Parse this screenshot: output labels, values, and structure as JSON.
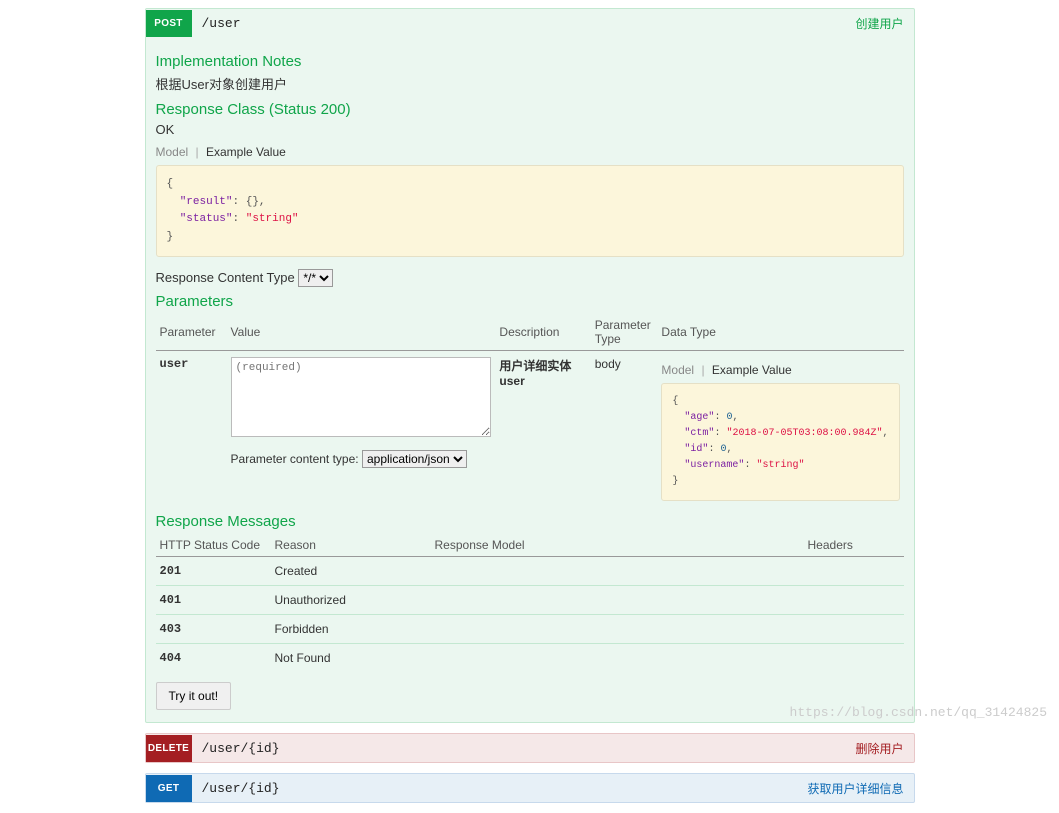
{
  "post_op": {
    "method": "POST",
    "path": "/user",
    "summary": "创建用户",
    "impl_notes_heading": "Implementation Notes",
    "impl_notes_text": "根据User对象创建用户",
    "response_class_heading": "Response Class (Status 200)",
    "response_class_text": "OK",
    "tabs": {
      "model": "Model",
      "example": "Example Value"
    },
    "response_example_render": "{\n  \"result\": {},\n  \"status\": \"string\"\n}",
    "response_content_type_label": "Response Content Type",
    "response_content_type_value": "*/*",
    "parameters_heading": "Parameters",
    "param_headers": {
      "parameter": "Parameter",
      "value": "Value",
      "description": "Description",
      "ptype": "Parameter Type",
      "dtype": "Data Type"
    },
    "param_row": {
      "name": "user",
      "placeholder": "(required)",
      "description": "用户详细实体user",
      "ptype": "body",
      "param_ct_label": "Parameter content type:",
      "param_ct_value": "application/json",
      "dt_tabs": {
        "model": "Model",
        "example": "Example Value"
      },
      "dt_example_render": "{\n  \"age\": 0,\n  \"ctm\": \"2018-07-05T03:08:00.984Z\",\n  \"id\": 0,\n  \"username\": \"string\"\n}"
    },
    "response_messages_heading": "Response Messages",
    "resp_headers": {
      "code": "HTTP Status Code",
      "reason": "Reason",
      "model": "Response Model",
      "headers": "Headers"
    },
    "responses": [
      {
        "code": "201",
        "reason": "Created"
      },
      {
        "code": "401",
        "reason": "Unauthorized"
      },
      {
        "code": "403",
        "reason": "Forbidden"
      },
      {
        "code": "404",
        "reason": "Not Found"
      }
    ],
    "try_label": "Try it out!"
  },
  "delete_op": {
    "method": "DELETE",
    "path": "/user/{id}",
    "summary": "删除用户"
  },
  "get_op": {
    "method": "GET",
    "path": "/user/{id}",
    "summary": "获取用户详细信息"
  },
  "watermark": "https://blog.csdn.net/qq_31424825"
}
